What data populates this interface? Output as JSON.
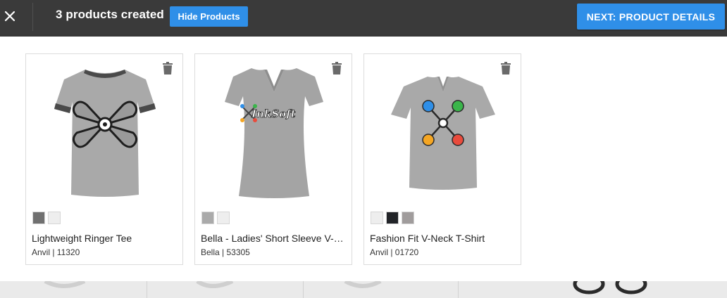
{
  "header": {
    "title": "3 products created",
    "hide_button": "Hide Products",
    "next_button": "NEXT: PRODUCT DETAILS"
  },
  "icons": {
    "close": "close-icon",
    "trash": "trash-icon"
  },
  "colors": {
    "topbar": "#3a3a3a",
    "accent": "#2f8fe8",
    "shirt_heather": "#a9a9a9"
  },
  "products": [
    {
      "name": "Lightweight Ringer Tee",
      "meta": "Anvil | 11320",
      "swatches": [
        "#707070",
        "#eeeeee"
      ]
    },
    {
      "name": "Bella - Ladies' Short Sleeve V-N...",
      "meta": "Bella | 53305",
      "logo_text": "InkSoft",
      "swatches": [
        "#aaaaaa",
        "#eeeeee"
      ]
    },
    {
      "name": "Fashion Fit V-Neck T-Shirt",
      "meta": "Anvil | 01720",
      "swatches": [
        "#eeeeee",
        "#222428",
        "#a09c9c"
      ]
    }
  ]
}
